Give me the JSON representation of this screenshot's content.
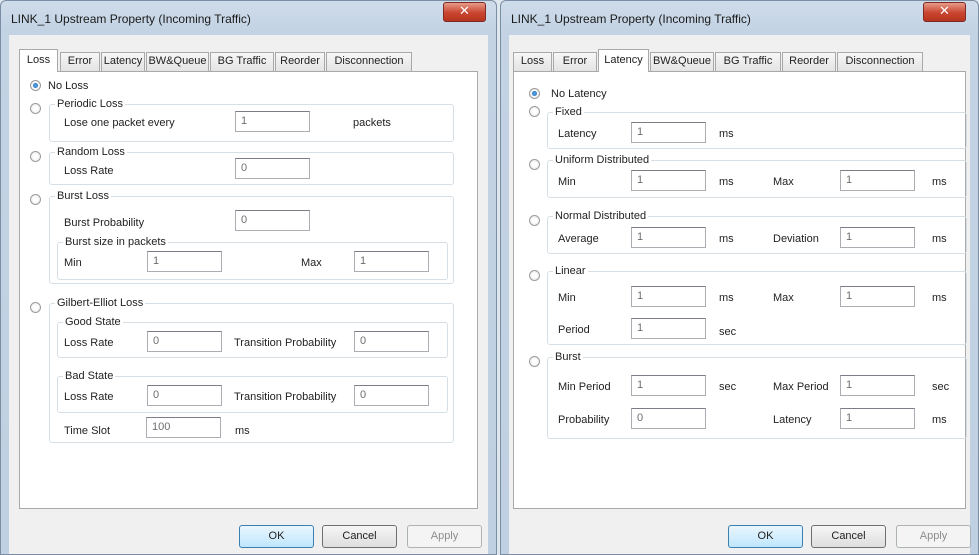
{
  "left": {
    "title": "LINK_1 Upstream Property (Incoming Traffic)",
    "close_glyph": "✕",
    "tabs": [
      "Loss",
      "Error",
      "Latency",
      "BW&Queue",
      "BG Traffic",
      "Reorder",
      "Disconnection"
    ],
    "active_tab": "Loss",
    "no_loss": "No Loss",
    "periodic": {
      "legend": "Periodic Loss",
      "label": "Lose one packet every",
      "value": "1",
      "unit": "packets"
    },
    "random": {
      "legend": "Random Loss",
      "label": "Loss Rate",
      "value": "0"
    },
    "burst": {
      "legend": "Burst Loss",
      "prob_label": "Burst Probability",
      "prob_value": "0",
      "size_legend": "Burst size in packets",
      "min_label": "Min",
      "min_value": "1",
      "max_label": "Max",
      "max_value": "1"
    },
    "gilbert": {
      "legend": "Gilbert-Elliot Loss",
      "good": {
        "legend": "Good State",
        "rate_label": "Loss Rate",
        "rate_value": "0",
        "trans_label": "Transition Probability",
        "trans_value": "0"
      },
      "bad": {
        "legend": "Bad State",
        "rate_label": "Loss Rate",
        "rate_value": "0",
        "trans_label": "Transition Probability",
        "trans_value": "0"
      },
      "slot_label": "Time Slot",
      "slot_value": "100",
      "slot_unit": "ms"
    },
    "buttons": {
      "ok": "OK",
      "cancel": "Cancel",
      "apply": "Apply"
    }
  },
  "right": {
    "title": "LINK_1 Upstream Property (Incoming Traffic)",
    "close_glyph": "✕",
    "tabs": [
      "Loss",
      "Error",
      "Latency",
      "BW&Queue",
      "BG Traffic",
      "Reorder",
      "Disconnection"
    ],
    "active_tab": "Latency",
    "no_latency": "No Latency",
    "fixed": {
      "legend": "Fixed",
      "label": "Latency",
      "value": "1",
      "unit": "ms"
    },
    "uniform": {
      "legend": "Uniform Distributed",
      "min_label": "Min",
      "min_value": "1",
      "min_unit": "ms",
      "max_label": "Max",
      "max_value": "1",
      "max_unit": "ms"
    },
    "normal": {
      "legend": "Normal Distributed",
      "avg_label": "Average",
      "avg_value": "1",
      "avg_unit": "ms",
      "dev_label": "Deviation",
      "dev_value": "1",
      "dev_unit": "ms"
    },
    "linear": {
      "legend": "Linear",
      "min_label": "Min",
      "min_value": "1",
      "min_unit": "ms",
      "max_label": "Max",
      "max_value": "1",
      "max_unit": "ms",
      "period_label": "Period",
      "period_value": "1",
      "period_unit": "sec"
    },
    "burst": {
      "legend": "Burst",
      "minp_label": "Min Period",
      "minp_value": "1",
      "minp_unit": "sec",
      "maxp_label": "Max Period",
      "maxp_value": "1",
      "maxp_unit": "sec",
      "prob_label": "Probability",
      "prob_value": "0",
      "lat_label": "Latency",
      "lat_value": "1",
      "lat_unit": "ms"
    },
    "buttons": {
      "ok": "OK",
      "cancel": "Cancel",
      "apply": "Apply"
    }
  }
}
